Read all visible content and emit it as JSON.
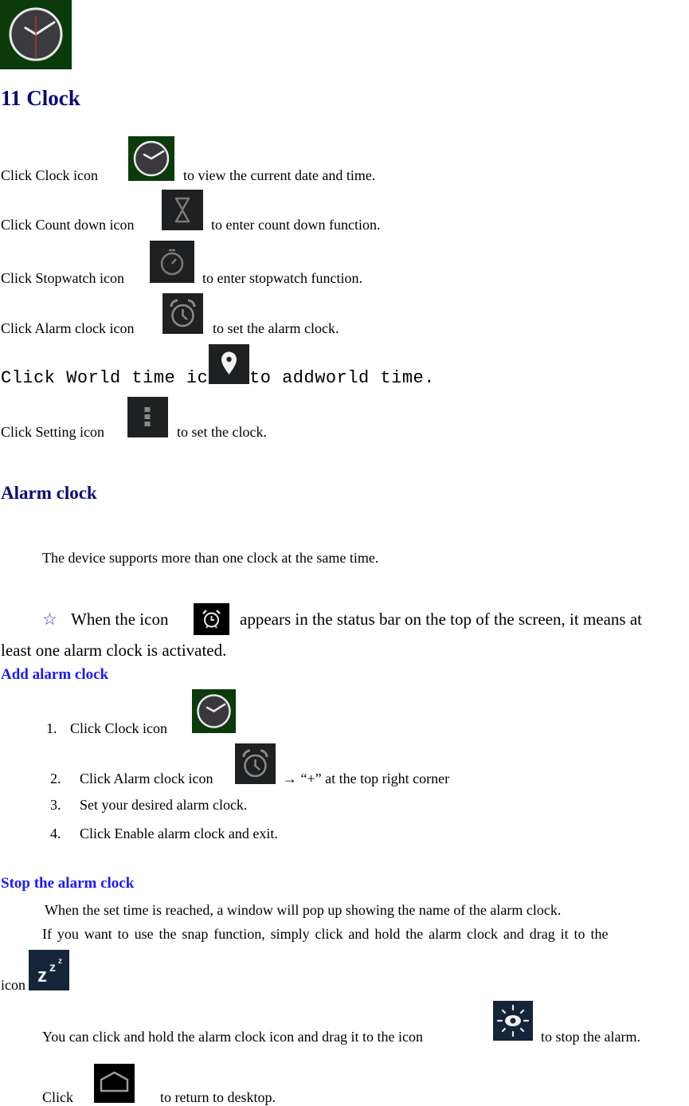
{
  "document": {
    "chapter_title": "11 Clock",
    "intro_lines": [
      {
        "before": "Click Clock icon",
        "after": "to view the current date and time.",
        "icon": "clock-app-icon"
      },
      {
        "before": "Click Count down icon",
        "after": "to enter count down function.",
        "icon": "hourglass-icon"
      },
      {
        "before": "Click Stopwatch icon",
        "after": "to enter stopwatch function.",
        "icon": "stopwatch-icon"
      },
      {
        "before": "Click Alarm clock icon",
        "after": "to set the alarm clock.",
        "icon": "alarm-clock-icon"
      },
      {
        "before": "Click World time icon",
        "after": " to addworld time.",
        "icon": "location-pin-icon"
      },
      {
        "before": "Click Setting icon",
        "after": "to set the clock.",
        "icon": "menu-dots-icon"
      }
    ],
    "alarm_section": {
      "title": "Alarm clock",
      "support_text": "The device supports more than one clock at the same time.",
      "star_glyph": "☆",
      "note_before": "When the icon",
      "note_after": "appears in the status bar on the top of the screen, it means at",
      "note_cont": "least one alarm clock is activated."
    },
    "add_alarm": {
      "title": "Add alarm clock",
      "steps": [
        {
          "num": "1.",
          "text": "Click Clock icon"
        },
        {
          "num": "2.",
          "text": "Click Alarm clock icon",
          "after": "→ “+” at the top right corner"
        },
        {
          "num": "3.",
          "text": "Set your desired alarm clock."
        },
        {
          "num": "4.",
          "text": "Click Enable alarm clock and exit."
        }
      ]
    },
    "stop_alarm": {
      "title": "Stop the alarm clock",
      "line1": "When the set time is reached, a window will pop up showing the name of the alarm clock.",
      "line2": "If you want to use the snap function, simply click and hold the alarm clock and drag it to the",
      "line2_cont": "icon",
      "line3_before": "You can click and hold the alarm clock icon and drag it to the icon",
      "line3_after": "to stop the alarm.",
      "line4_before": "Click",
      "line4_after": "to return to desktop."
    }
  },
  "colors": {
    "heading_dark_blue": "#0a0a78",
    "heading_blue": "#1a1aff",
    "clock_icon_bg": "#0b3a0b",
    "dark_icon_bg": "#1f2022",
    "snooze_icon_bg": "#16243a"
  }
}
